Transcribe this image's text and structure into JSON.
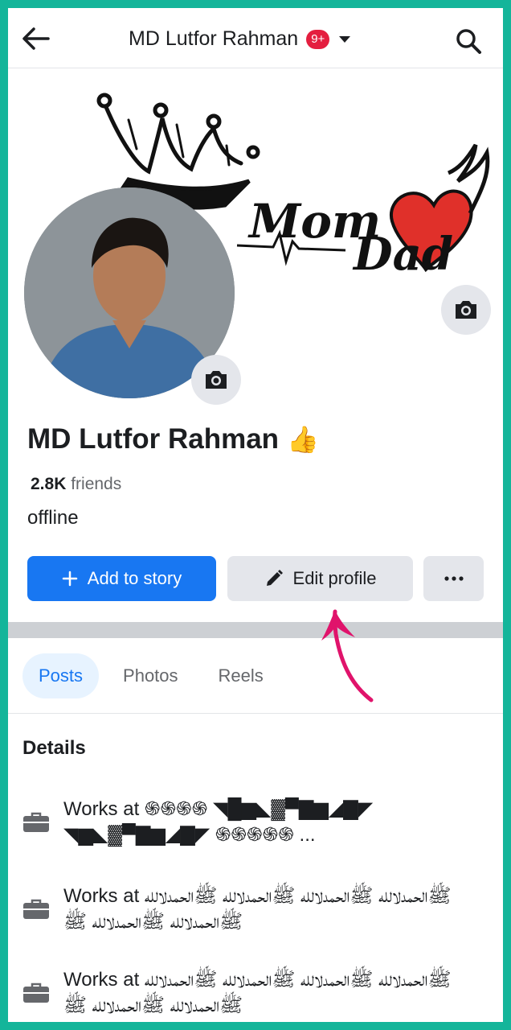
{
  "header": {
    "title": "MD Lutfor Rahman",
    "notification_badge": "9+",
    "back_icon": "back-arrow-icon",
    "search_icon": "search-icon"
  },
  "cover": {
    "artwork_text_mom": "Mom",
    "artwork_text_dad": "Dad"
  },
  "profile": {
    "name": "MD Lutfor Rahman",
    "name_emoji": "👍",
    "friends_count": "2.8K",
    "friends_label": "friends",
    "status": "offline"
  },
  "actions": {
    "add_story": "Add to story",
    "edit_profile": "Edit profile"
  },
  "tabs": [
    {
      "label": "Posts"
    },
    {
      "label": "Photos"
    },
    {
      "label": "Reels"
    }
  ],
  "details": {
    "title": "Details",
    "items": [
      {
        "text": "Works at ֍֍֍֍ ◥█▆◣▓▀▇▆◢▇◤ ◥▆◣▓▀▇▆◢▇◤ ֍֍֍֍֍ ..."
      },
      {
        "text": "Works at ﷺالحمدلالله ﷺالحمدلالله ﷺالحمدلالله ﷺالحمدلالله ﷺالحمدلالله ﷺالحمدلالله ﷺ"
      },
      {
        "text": "Works at ﷺالحمدلالله ﷺالحمدلالله ﷺالحمدلالله ﷺالحمدلالله ﷺالحمدلالله ﷺالحمدلالله ﷺ"
      }
    ]
  },
  "colors": {
    "accent": "#1877f2",
    "frame": "#14b59a",
    "badge": "#e41e3f",
    "annotation_arrow": "#e0136b"
  }
}
